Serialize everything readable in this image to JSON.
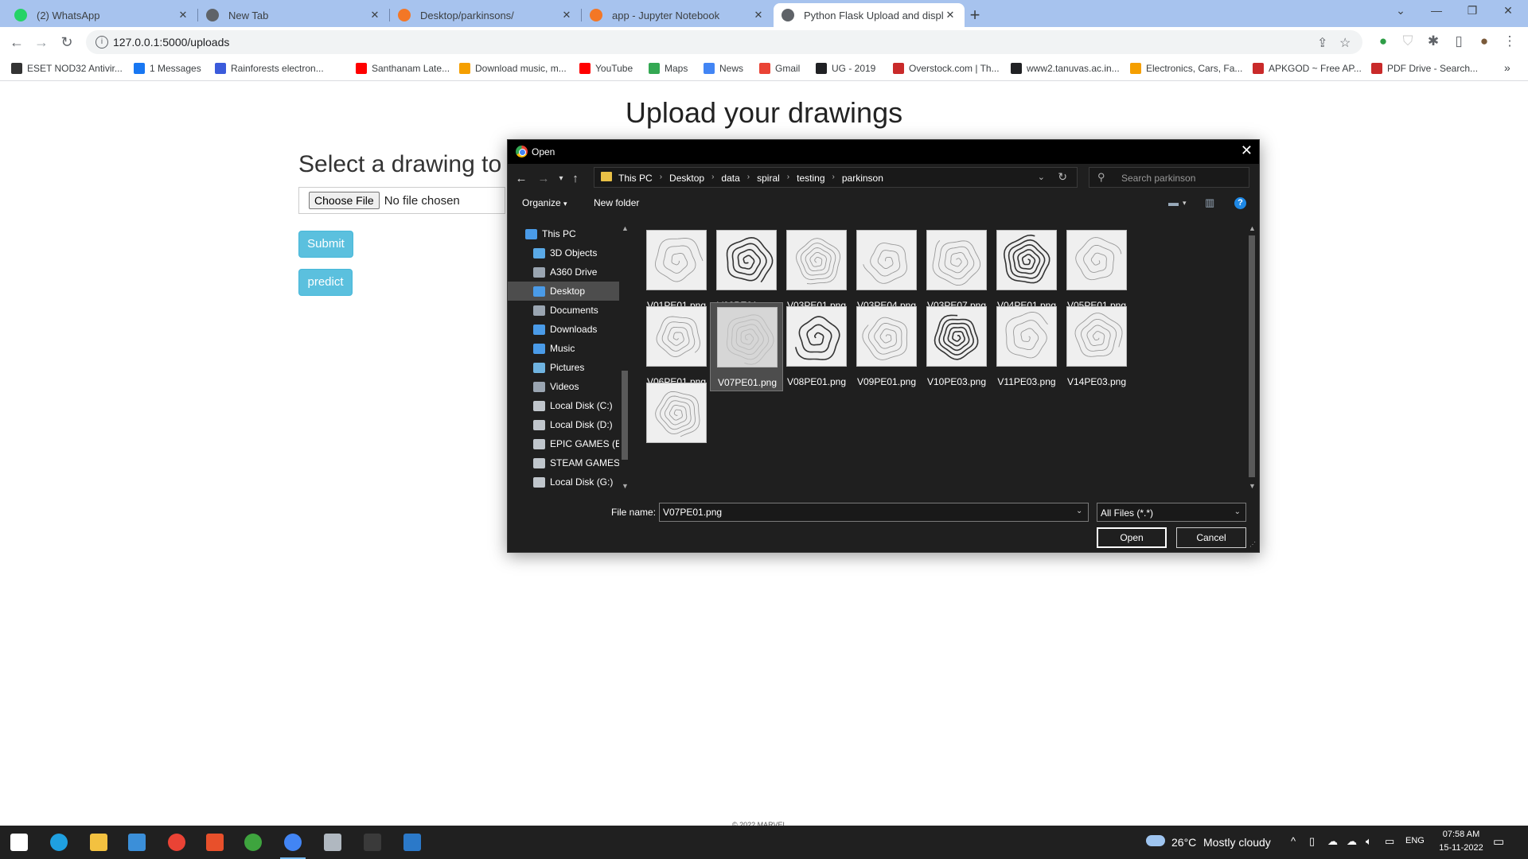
{
  "browser": {
    "tabs": [
      {
        "title": "(2) WhatsApp",
        "icon": "whatsapp-icon",
        "color": "#25d366"
      },
      {
        "title": "New Tab",
        "icon": "chrome-icon",
        "color": "#5f6368"
      },
      {
        "title": "Desktop/parkinsons/",
        "icon": "jupyter-icon",
        "color": "#f37726"
      },
      {
        "title": "app - Jupyter Notebook",
        "icon": "jupyter-icon",
        "color": "#f37726"
      },
      {
        "title": "Python Flask Upload and display",
        "icon": "globe-icon",
        "color": "#5f6368"
      }
    ],
    "url": "127.0.0.1:5000/uploads",
    "bookmarks": [
      {
        "label": "ESET NOD32 Antivir...",
        "icon": "eset-icon",
        "color": "#333333"
      },
      {
        "label": "1 Messages",
        "icon": "facebook-icon",
        "color": "#1877f2"
      },
      {
        "label": "Rainforests electron...",
        "icon": "bookmark-icon",
        "color": "#3b5bdb"
      },
      {
        "label": "Santhanam Late...",
        "icon": "youtube-icon",
        "color": "#ff0000"
      },
      {
        "label": "Download music, m...",
        "icon": "music-icon",
        "color": "#f59f00"
      },
      {
        "label": "YouTube",
        "icon": "youtube-icon",
        "color": "#ff0000"
      },
      {
        "label": "Maps",
        "icon": "maps-icon",
        "color": "#34a853"
      },
      {
        "label": "News",
        "icon": "news-icon",
        "color": "#4285f4"
      },
      {
        "label": "Gmail",
        "icon": "gmail-icon",
        "color": "#ea4335"
      },
      {
        "label": "UG - 2019",
        "icon": "globe-icon",
        "color": "#202124"
      },
      {
        "label": "Overstock.com | Th...",
        "icon": "overstock-icon",
        "color": "#c92a2a"
      },
      {
        "label": "www2.tanuvas.ac.in...",
        "icon": "globe-icon",
        "color": "#202124"
      },
      {
        "label": "Electronics, Cars, Fa...",
        "icon": "shopping-icon",
        "color": "#f59f00"
      },
      {
        "label": "APKGOD ~ Free AP...",
        "icon": "apkgod-icon",
        "color": "#c92a2a"
      },
      {
        "label": "PDF Drive - Search...",
        "icon": "pdf-icon",
        "color": "#c92a2a"
      }
    ]
  },
  "page": {
    "title": "Upload your drawings",
    "subtitle": "Select a drawing to",
    "choose_file_label": "Choose File",
    "no_file_text": "No file chosen",
    "submit_label": "Submit",
    "predict_label": "predict",
    "footer": "© 2022 MARVEL"
  },
  "dialog": {
    "title": "Open",
    "breadcrumb": [
      "This PC",
      "Desktop",
      "data",
      "spiral",
      "testing",
      "parkinson"
    ],
    "search_placeholder": "Search parkinson",
    "organize_label": "Organize",
    "new_folder_label": "New folder",
    "nav_items": [
      {
        "label": "This PC",
        "icon": "computer-icon",
        "color": "#4a9be8"
      },
      {
        "label": "3D Objects",
        "icon": "cube-icon",
        "color": "#5aa9e6"
      },
      {
        "label": "A360 Drive",
        "icon": "cloud-drive-icon",
        "color": "#9aa5b1"
      },
      {
        "label": "Desktop",
        "icon": "desktop-icon",
        "color": "#4a9be8",
        "selected": true
      },
      {
        "label": "Documents",
        "icon": "documents-icon",
        "color": "#9aa5b1"
      },
      {
        "label": "Downloads",
        "icon": "downloads-icon",
        "color": "#4a9be8"
      },
      {
        "label": "Music",
        "icon": "music-icon",
        "color": "#4a9be8"
      },
      {
        "label": "Pictures",
        "icon": "pictures-icon",
        "color": "#6fb3e0"
      },
      {
        "label": "Videos",
        "icon": "videos-icon",
        "color": "#9aa5b1"
      },
      {
        "label": "Local Disk (C:)",
        "icon": "drive-icon",
        "color": "#c0c6cc"
      },
      {
        "label": "Local Disk (D:)",
        "icon": "drive-icon",
        "color": "#c0c6cc"
      },
      {
        "label": "EPIC GAMES (E:)",
        "icon": "drive-icon",
        "color": "#c0c6cc"
      },
      {
        "label": "STEAM GAMES (",
        "icon": "drive-icon",
        "color": "#c0c6cc"
      },
      {
        "label": "Local Disk (G:)",
        "icon": "drive-icon",
        "color": "#c0c6cc"
      }
    ],
    "files": [
      {
        "name": "V01PE01.png"
      },
      {
        "name": "V02PE01.png"
      },
      {
        "name": "V03PE01.png"
      },
      {
        "name": "V03PE04.png"
      },
      {
        "name": "V03PE07.png"
      },
      {
        "name": "V04PE01.png"
      },
      {
        "name": "V05PE01.png"
      },
      {
        "name": "V06PE01.png"
      },
      {
        "name": "V07PE01.png",
        "selected": true
      },
      {
        "name": "V08PE01.png"
      },
      {
        "name": "V09PE01.png"
      },
      {
        "name": "V10PE03.png"
      },
      {
        "name": "V11PE03.png"
      },
      {
        "name": "V14PE03.png"
      },
      {
        "name": ""
      }
    ],
    "file_name_label": "File name:",
    "file_name_value": "V07PE01.png",
    "file_type": "All Files (*.*)",
    "open_label": "Open",
    "cancel_label": "Cancel"
  },
  "taskbar": {
    "apps": [
      {
        "icon": "windows-start-icon",
        "color": "#ffffff"
      },
      {
        "icon": "edge-icon",
        "color": "#1fa0e0"
      },
      {
        "icon": "file-explorer-icon",
        "color": "#f3c140"
      },
      {
        "icon": "store-icon",
        "color": "#3b8fd9"
      },
      {
        "icon": "chrome-icon",
        "color": "#ea4335"
      },
      {
        "icon": "office-icon",
        "color": "#e8502b"
      },
      {
        "icon": "xbox-icon",
        "color": "#3ea43e"
      },
      {
        "icon": "chrome-icon",
        "color": "#4285f4",
        "active": true
      },
      {
        "icon": "notepad-icon",
        "color": "#b0b8c0"
      },
      {
        "icon": "terminal-icon",
        "color": "#3a3a3a"
      },
      {
        "icon": "photos-icon",
        "color": "#2b79c9"
      }
    ],
    "weather_temp": "26°C",
    "weather_desc": "Mostly cloudy",
    "language": "ENG",
    "time": "07:58 AM",
    "date": "15-11-2022"
  }
}
